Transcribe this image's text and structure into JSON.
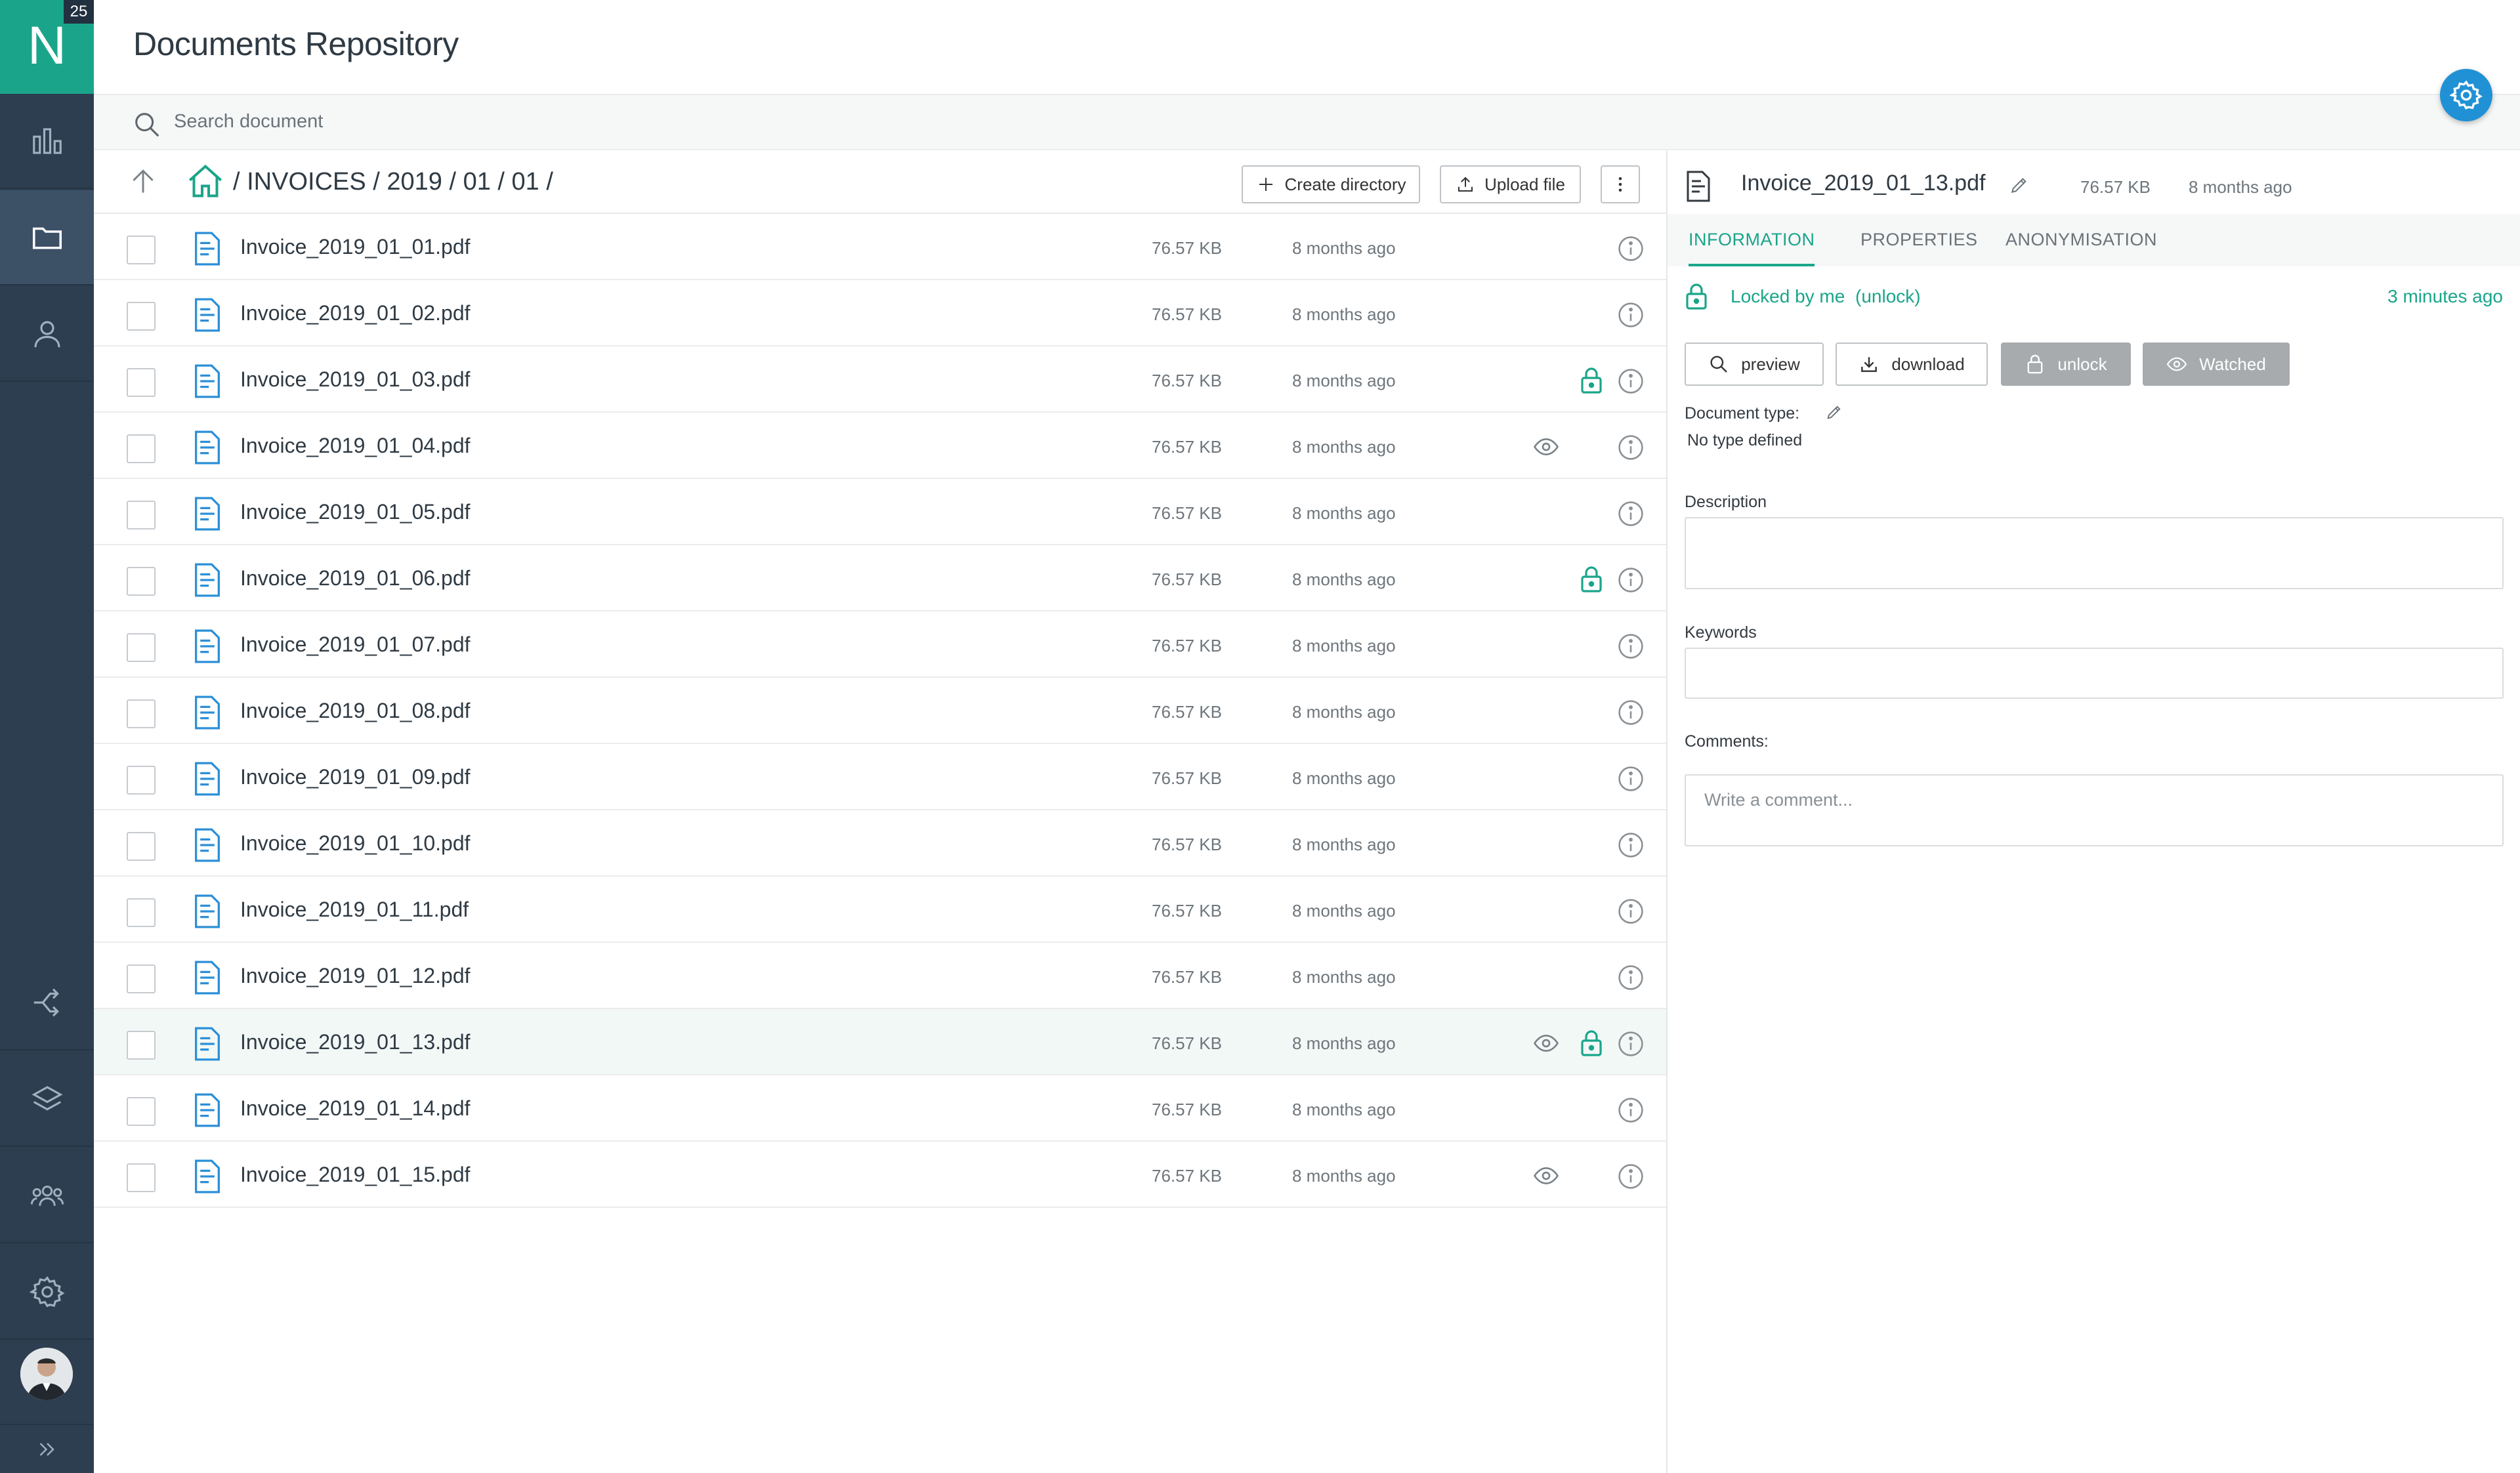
{
  "app": {
    "logo_letter": "N",
    "badge": "25",
    "title": "Documents Repository"
  },
  "nav": {
    "items": [
      {
        "icon": "bar-chart-icon"
      },
      {
        "icon": "folder-icon"
      },
      {
        "icon": "user-icon"
      },
      {
        "icon": "workflow-icon"
      },
      {
        "icon": "layers-icon"
      },
      {
        "icon": "group-icon"
      },
      {
        "icon": "gear-icon"
      }
    ],
    "expand_icon": "double-chevron-right-icon"
  },
  "search": {
    "placeholder": "Search document"
  },
  "toolbar": {
    "breadcrumb": "/ INVOICES / 2019 / 01 / 01 /",
    "create_directory": "Create directory",
    "upload_file": "Upload file"
  },
  "files": [
    {
      "name": "Invoice_2019_01_01.pdf",
      "size": "76.57 KB",
      "modified": "8 months ago",
      "watched": false,
      "locked": false
    },
    {
      "name": "Invoice_2019_01_02.pdf",
      "size": "76.57 KB",
      "modified": "8 months ago",
      "watched": false,
      "locked": false
    },
    {
      "name": "Invoice_2019_01_03.pdf",
      "size": "76.57 KB",
      "modified": "8 months ago",
      "watched": false,
      "locked": true
    },
    {
      "name": "Invoice_2019_01_04.pdf",
      "size": "76.57 KB",
      "modified": "8 months ago",
      "watched": true,
      "locked": false
    },
    {
      "name": "Invoice_2019_01_05.pdf",
      "size": "76.57 KB",
      "modified": "8 months ago",
      "watched": false,
      "locked": false
    },
    {
      "name": "Invoice_2019_01_06.pdf",
      "size": "76.57 KB",
      "modified": "8 months ago",
      "watched": false,
      "locked": true
    },
    {
      "name": "Invoice_2019_01_07.pdf",
      "size": "76.57 KB",
      "modified": "8 months ago",
      "watched": false,
      "locked": false
    },
    {
      "name": "Invoice_2019_01_08.pdf",
      "size": "76.57 KB",
      "modified": "8 months ago",
      "watched": false,
      "locked": false
    },
    {
      "name": "Invoice_2019_01_09.pdf",
      "size": "76.57 KB",
      "modified": "8 months ago",
      "watched": false,
      "locked": false
    },
    {
      "name": "Invoice_2019_01_10.pdf",
      "size": "76.57 KB",
      "modified": "8 months ago",
      "watched": false,
      "locked": false
    },
    {
      "name": "Invoice_2019_01_11.pdf",
      "size": "76.57 KB",
      "modified": "8 months ago",
      "watched": false,
      "locked": false
    },
    {
      "name": "Invoice_2019_01_12.pdf",
      "size": "76.57 KB",
      "modified": "8 months ago",
      "watched": false,
      "locked": false
    },
    {
      "name": "Invoice_2019_01_13.pdf",
      "size": "76.57 KB",
      "modified": "8 months ago",
      "watched": true,
      "locked": true,
      "selected": true
    },
    {
      "name": "Invoice_2019_01_14.pdf",
      "size": "76.57 KB",
      "modified": "8 months ago",
      "watched": false,
      "locked": false
    },
    {
      "name": "Invoice_2019_01_15.pdf",
      "size": "76.57 KB",
      "modified": "8 months ago",
      "watched": true,
      "locked": false
    }
  ],
  "details": {
    "title": "Invoice_2019_01_13.pdf",
    "size": "76.57 KB",
    "modified": "8 months ago",
    "tabs": [
      {
        "label": "INFORMATION",
        "active": true
      },
      {
        "label": "PROPERTIES",
        "active": false
      },
      {
        "label": "ANONYMISATION",
        "active": false
      }
    ],
    "lock_status": "Locked by me",
    "unlock_link": "(unlock)",
    "lock_time": "3 minutes ago",
    "actions": {
      "preview": "preview",
      "download": "download",
      "unlock": "unlock",
      "watched": "Watched"
    },
    "document_type_label": "Document type:",
    "document_type_value": "No type defined",
    "description_label": "Description",
    "keywords_label": "Keywords",
    "comments_label": "Comments:",
    "comment_placeholder": "Write a comment..."
  },
  "colors": {
    "nav_bg": "#2d3e50",
    "accent": "#1aa58a",
    "fab": "#2191d6",
    "file_icon": "#2a8fd8"
  }
}
